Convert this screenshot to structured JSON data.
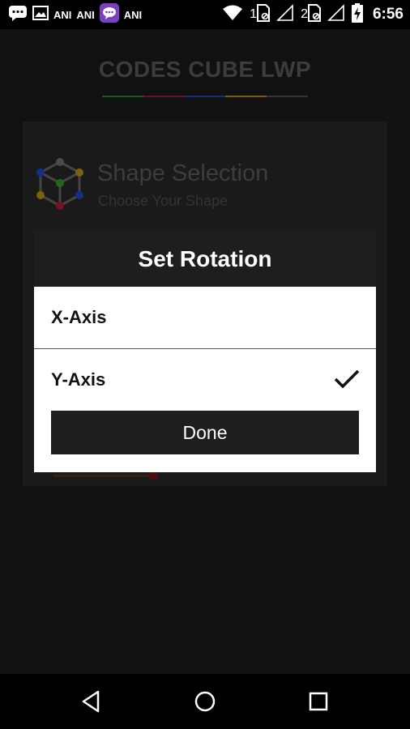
{
  "status_bar": {
    "notifications": [
      {
        "icon": "chat-bubble-icon"
      },
      {
        "icon": "image-icon"
      },
      {
        "label": "ANI"
      },
      {
        "label": "ANI"
      },
      {
        "icon": "messenger-icon"
      },
      {
        "label": "ANI"
      }
    ],
    "sim1": "1",
    "sim2": "2",
    "time": "6:56",
    "icons": [
      "wifi-icon",
      "sim-card-icon",
      "signal-icon",
      "battery-charging-icon"
    ]
  },
  "app": {
    "title": "CODES CUBE LWP",
    "underline_colors": [
      "#1a6a1a",
      "#7a1020",
      "#12308a",
      "#8a6a10",
      "#3a3a3a"
    ],
    "card": {
      "title": "Shape Selection",
      "subtitle": "Choose Your Shape",
      "icon": "cube-icon"
    }
  },
  "dialog": {
    "title": "Set Rotation",
    "options": [
      {
        "label": "X-Axis",
        "selected": false
      },
      {
        "label": "Y-Axis",
        "selected": true
      }
    ],
    "done_label": "Done"
  },
  "nav_bar": {
    "buttons": [
      "back-icon",
      "home-icon",
      "recents-icon"
    ]
  }
}
